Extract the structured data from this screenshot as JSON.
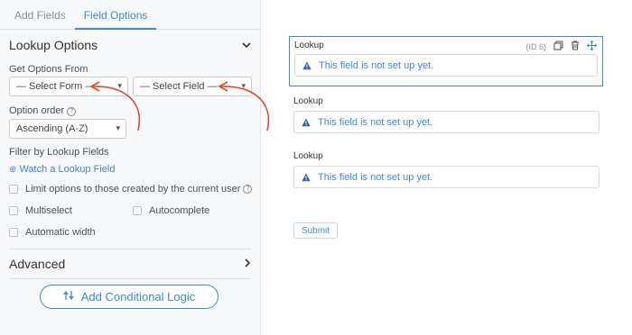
{
  "tabs": [
    {
      "label": "Add Fields",
      "active": false
    },
    {
      "label": "Field Options",
      "active": true
    }
  ],
  "lookup_options": {
    "title": "Lookup Options",
    "get_options_label": "Get Options From",
    "select_form": "— Select Form —",
    "select_field": "— Select Field —",
    "option_order_label": "Option order",
    "option_order_value": "Ascending (A-Z)",
    "filter_label": "Filter by Lookup Fields",
    "watch_link": "Watch a Lookup Field",
    "checkboxes": {
      "limit": "Limit options to those created by the current user",
      "multiselect": "Multiselect",
      "autocomplete": "Autocomplete",
      "autowidth": "Automatic width"
    }
  },
  "advanced": {
    "title": "Advanced"
  },
  "conditional_button": "Add Conditional Logic",
  "fields": [
    {
      "label": "Lookup",
      "id_text": "(ID 6)",
      "notice": "This field is not set up yet."
    },
    {
      "label": "Lookup",
      "notice": "This field is not set up yet."
    },
    {
      "label": "Lookup",
      "notice": "This field is not set up yet."
    }
  ],
  "submit_label": "Submit",
  "colors": {
    "accent": "#3b87e0",
    "arrow": "#e04a2a"
  }
}
